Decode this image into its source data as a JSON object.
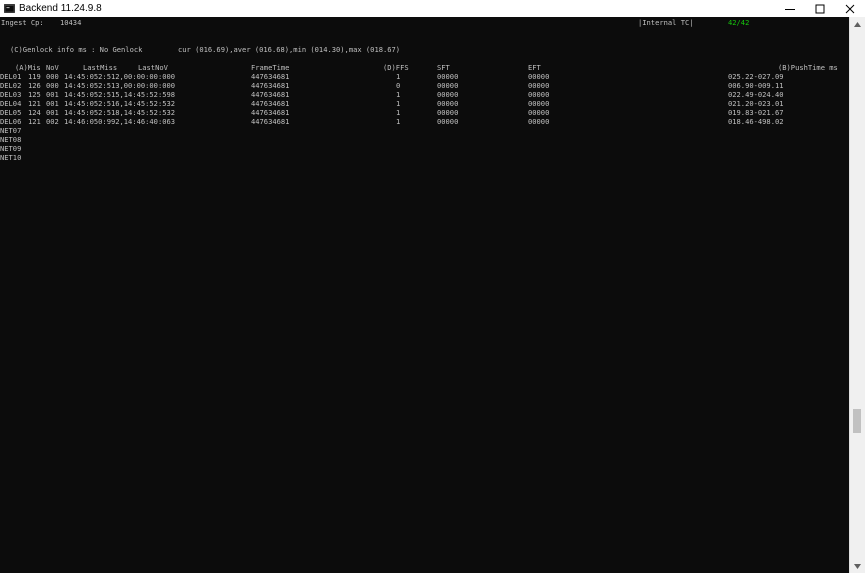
{
  "window": {
    "title": "Backend 11.24.9.8"
  },
  "header": {
    "ingest_label": "Ingest Cp:",
    "ingest_value": "10434",
    "tc_label": "|Internal TC|",
    "tc_value": "42/42"
  },
  "genlock": {
    "label": "(C)Genlock info ms : No Genlock",
    "stats": "cur (016.69),aver (016.68),min (014.30),max (018.67)"
  },
  "columns": {
    "mis": "(A)Mis",
    "nov": "NoV",
    "last_miss": "LastMiss",
    "last_nov": "LastNoV",
    "frame_time": "FrameTime",
    "ffs": "(D)FFS",
    "sft": "SFT",
    "eft": "EFT",
    "push_time": "(B)PushTime ms"
  },
  "rows": [
    {
      "name": "DEL01",
      "mis": "119",
      "nov": "000",
      "miss_times": "14:45:052:512,00:00:00:000",
      "frame_time": "447634681",
      "ffs": "1",
      "sft": "00000",
      "eft": "00000",
      "push": "025.22-027.09"
    },
    {
      "name": "DEL02",
      "mis": "126",
      "nov": "000",
      "miss_times": "14:45:052:513,00:00:00:000",
      "frame_time": "447634681",
      "ffs": "0",
      "sft": "00000",
      "eft": "00000",
      "push": "006.90-009.11"
    },
    {
      "name": "DEL03",
      "mis": "125",
      "nov": "001",
      "miss_times": "14:45:052:515,14:45:52:598",
      "frame_time": "447634681",
      "ffs": "1",
      "sft": "00000",
      "eft": "00000",
      "push": "022.49-024.40"
    },
    {
      "name": "DEL04",
      "mis": "121",
      "nov": "001",
      "miss_times": "14:45:052:516,14:45:52:532",
      "frame_time": "447634681",
      "ffs": "1",
      "sft": "00000",
      "eft": "00000",
      "push": "021.20-023.01"
    },
    {
      "name": "DEL05",
      "mis": "124",
      "nov": "001",
      "miss_times": "14:45:052:518,14:45:52:532",
      "frame_time": "447634681",
      "ffs": "1",
      "sft": "00000",
      "eft": "00000",
      "push": "019.83-021.67"
    },
    {
      "name": "DEL06",
      "mis": "121",
      "nov": "002",
      "miss_times": "14:46:050:992,14:46:40:063",
      "frame_time": "447634681",
      "ffs": "1",
      "sft": "00000",
      "eft": "00000",
      "push": "018.46-498.02"
    }
  ],
  "net_rows": [
    "NET07",
    "NET08",
    "NET09",
    "NET10"
  ],
  "icons": {
    "app": "console-app-icon",
    "minimize": "minimize-icon",
    "maximize": "maximize-icon",
    "close": "close-icon"
  },
  "colors": {
    "console_bg": "#0c0c0c",
    "console_text": "#c0c0c0",
    "status_green": "#16c60c"
  }
}
